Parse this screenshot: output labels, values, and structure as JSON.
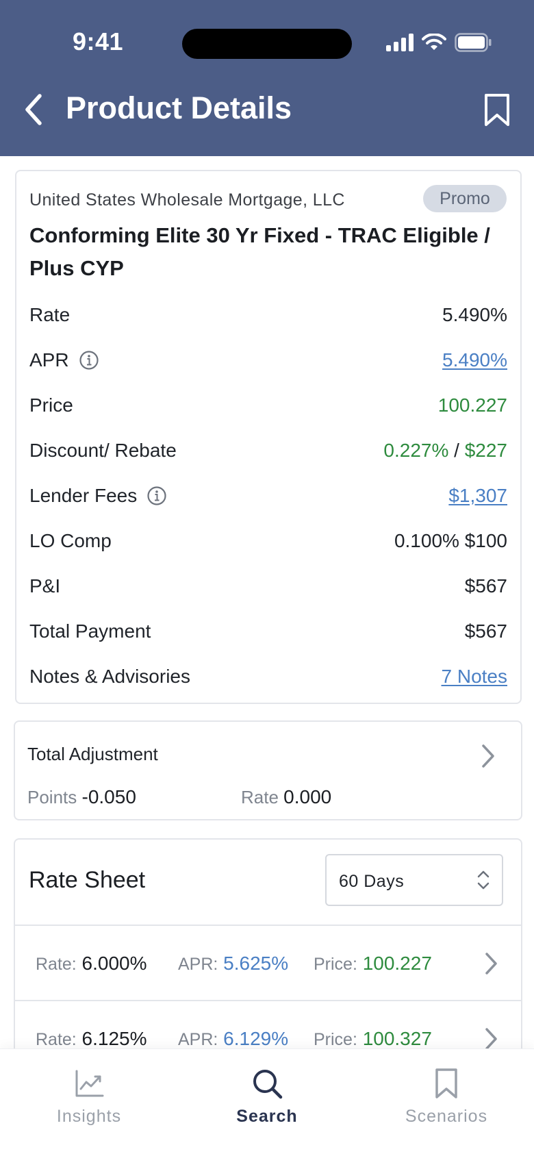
{
  "status_bar": {
    "time": "9:41"
  },
  "header": {
    "title": "Product Details"
  },
  "product": {
    "lender": "United States Wholesale Mortgage, LLC",
    "badge": "Promo",
    "name": "Conforming Elite 30 Yr Fixed - TRAC Eligible / Plus CYP",
    "rows": {
      "rate": {
        "label": "Rate",
        "value": "5.490%"
      },
      "apr": {
        "label": "APR",
        "value": "5.490%"
      },
      "price": {
        "label": "Price",
        "value": "100.227"
      },
      "discount": {
        "label": "Discount/ Rebate",
        "value_pct": "0.227%",
        "separator": "/",
        "value_amt": "$227"
      },
      "lender_fees": {
        "label": "Lender Fees",
        "value": "$1,307"
      },
      "lo_comp": {
        "label": "LO Comp",
        "value": "0.100% $100"
      },
      "pi": {
        "label": "P&I",
        "value": "$567"
      },
      "total_payment": {
        "label": "Total Payment",
        "value": "$567"
      },
      "notes": {
        "label": "Notes & Advisories",
        "value": "7 Notes"
      }
    }
  },
  "adjustment": {
    "title": "Total Adjustment",
    "points_label": "Points",
    "points_value": "-0.050",
    "rate_label": "Rate",
    "rate_value": "0.000"
  },
  "rate_sheet": {
    "title": "Rate Sheet",
    "lock_period": "60 Days",
    "rate_label": "Rate:",
    "apr_label": "APR:",
    "price_label": "Price:",
    "rows": [
      {
        "rate": "6.000%",
        "apr": "5.625%",
        "price": "100.227"
      },
      {
        "rate": "6.125%",
        "apr": "6.129%",
        "price": "100.327"
      }
    ]
  },
  "tabbar": {
    "items": [
      {
        "label": "Insights",
        "icon": "chart-icon"
      },
      {
        "label": "Search",
        "icon": "search-icon"
      },
      {
        "label": "Scenarios",
        "icon": "bookmark-icon"
      }
    ],
    "active": "Search"
  },
  "colors": {
    "header_bg": "#4c5d87",
    "link_blue": "#4a7fc4",
    "positive_green": "#2e8b3e",
    "promo_bg": "#d6dbe4",
    "tab_active": "#2a3450"
  }
}
